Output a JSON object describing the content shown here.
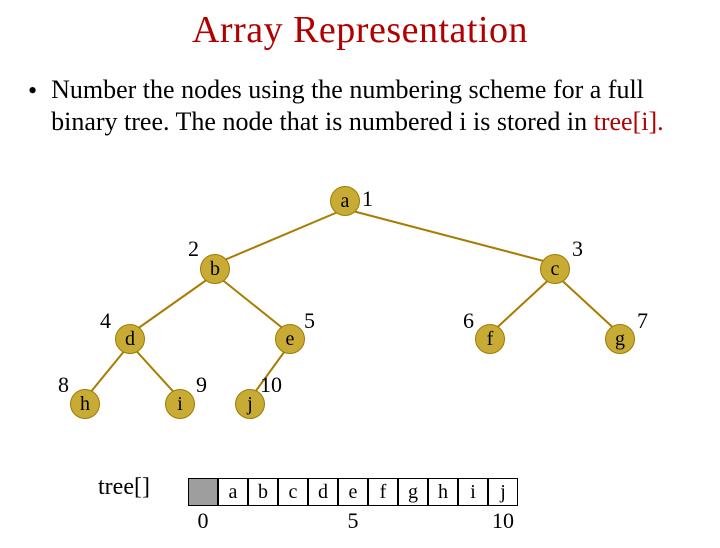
{
  "title": "Array Representation",
  "bullet": "Number the nodes using the numbering scheme for a full binary tree. The node that is numbered i is stored in ",
  "tree_i": "tree[i].",
  "nodes": {
    "a": {
      "label": "a",
      "num": "1"
    },
    "b": {
      "label": "b",
      "num": "2"
    },
    "c": {
      "label": "c",
      "num": "3"
    },
    "d": {
      "label": "d",
      "num": "4"
    },
    "e": {
      "label": "e",
      "num": "5"
    },
    "f": {
      "label": "f",
      "num": "6"
    },
    "g": {
      "label": "g",
      "num": "7"
    },
    "h": {
      "label": "h",
      "num": "8"
    },
    "i": {
      "label": "i",
      "num": "9"
    },
    "j": {
      "label": "j",
      "num": "10"
    }
  },
  "array_label": "tree[]",
  "array_cells": [
    "",
    "a",
    "b",
    "c",
    "d",
    "e",
    "f",
    "g",
    "h",
    "i",
    "j"
  ],
  "array_indices": {
    "i0": "0",
    "i5": "5",
    "i10": "10"
  },
  "chart_data": {
    "type": "tree",
    "title": "Array Representation",
    "description": "Full binary tree numbering and its array storage tree[i]",
    "nodes": [
      {
        "index": 1,
        "label": "a",
        "children": [
          2,
          3
        ]
      },
      {
        "index": 2,
        "label": "b",
        "children": [
          4,
          5
        ]
      },
      {
        "index": 3,
        "label": "c",
        "children": [
          6,
          7
        ]
      },
      {
        "index": 4,
        "label": "d",
        "children": [
          8,
          9
        ]
      },
      {
        "index": 5,
        "label": "e",
        "children": [
          10
        ]
      },
      {
        "index": 6,
        "label": "f",
        "children": []
      },
      {
        "index": 7,
        "label": "g",
        "children": []
      },
      {
        "index": 8,
        "label": "h",
        "children": []
      },
      {
        "index": 9,
        "label": "i",
        "children": []
      },
      {
        "index": 10,
        "label": "j",
        "children": []
      }
    ],
    "array": [
      null,
      "a",
      "b",
      "c",
      "d",
      "e",
      "f",
      "g",
      "h",
      "i",
      "j"
    ],
    "index_labels_shown": [
      0,
      5,
      10
    ]
  }
}
